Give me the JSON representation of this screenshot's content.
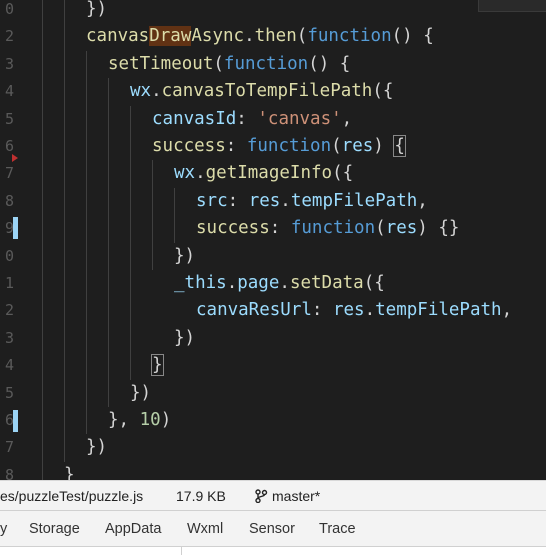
{
  "editor": {
    "line_numbers": [
      "0",
      "2",
      "3",
      "4",
      "5",
      "6",
      "7",
      "8",
      "9",
      "0",
      "1",
      "2",
      "3",
      "4",
      "5",
      "6",
      "7",
      "8"
    ],
    "lines": [
      {
        "tokens": [
          {
            "t": "})",
            "c": "plain"
          }
        ]
      },
      {
        "tokens": [
          {
            "t": "canvas",
            "c": "fn"
          },
          {
            "t": "Draw",
            "c": "fn",
            "hl": true
          },
          {
            "t": "Async",
            "c": "fn"
          },
          {
            "t": ".",
            "c": "plain"
          },
          {
            "t": "then",
            "c": "fn"
          },
          {
            "t": "(",
            "c": "plain"
          },
          {
            "t": "function",
            "c": "kw"
          },
          {
            "t": "() {",
            "c": "plain"
          }
        ]
      },
      {
        "tokens": [
          {
            "t": "setTimeout",
            "c": "fn"
          },
          {
            "t": "(",
            "c": "plain"
          },
          {
            "t": "function",
            "c": "kw"
          },
          {
            "t": "() {",
            "c": "plain"
          }
        ]
      },
      {
        "tokens": [
          {
            "t": "wx",
            "c": "prop"
          },
          {
            "t": ".",
            "c": "plain"
          },
          {
            "t": "canvasToTempFilePath",
            "c": "fn"
          },
          {
            "t": "({",
            "c": "plain"
          }
        ]
      },
      {
        "tokens": [
          {
            "t": "canvasId",
            "c": "prop"
          },
          {
            "t": ": ",
            "c": "plain"
          },
          {
            "t": "'canvas'",
            "c": "str"
          },
          {
            "t": ",",
            "c": "plain"
          }
        ]
      },
      {
        "tokens": [
          {
            "t": "success",
            "c": "fn"
          },
          {
            "t": ": ",
            "c": "plain"
          },
          {
            "t": "function",
            "c": "kw"
          },
          {
            "t": "(",
            "c": "plain"
          },
          {
            "t": "res",
            "c": "prop"
          },
          {
            "t": ") ",
            "c": "plain"
          },
          {
            "t": "{",
            "c": "plain",
            "box": true
          }
        ]
      },
      {
        "tokens": [
          {
            "t": "wx",
            "c": "prop"
          },
          {
            "t": ".",
            "c": "plain"
          },
          {
            "t": "getImageInfo",
            "c": "fn"
          },
          {
            "t": "({",
            "c": "plain"
          }
        ]
      },
      {
        "tokens": [
          {
            "t": "src",
            "c": "prop"
          },
          {
            "t": ": ",
            "c": "plain"
          },
          {
            "t": "res",
            "c": "prop"
          },
          {
            "t": ".",
            "c": "plain"
          },
          {
            "t": "tempFilePath",
            "c": "prop"
          },
          {
            "t": ",",
            "c": "plain"
          }
        ]
      },
      {
        "tokens": [
          {
            "t": "success",
            "c": "fn"
          },
          {
            "t": ": ",
            "c": "plain"
          },
          {
            "t": "function",
            "c": "kw"
          },
          {
            "t": "(",
            "c": "plain"
          },
          {
            "t": "res",
            "c": "prop"
          },
          {
            "t": ") {}",
            "c": "plain"
          }
        ]
      },
      {
        "tokens": [
          {
            "t": "})",
            "c": "plain"
          }
        ]
      },
      {
        "tokens": [
          {
            "t": "_this",
            "c": "prop"
          },
          {
            "t": ".",
            "c": "plain"
          },
          {
            "t": "page",
            "c": "prop"
          },
          {
            "t": ".",
            "c": "plain"
          },
          {
            "t": "setData",
            "c": "fn"
          },
          {
            "t": "({",
            "c": "plain"
          }
        ]
      },
      {
        "tokens": [
          {
            "t": "canvaResUrl",
            "c": "prop"
          },
          {
            "t": ": ",
            "c": "plain"
          },
          {
            "t": "res",
            "c": "prop"
          },
          {
            "t": ".",
            "c": "plain"
          },
          {
            "t": "tempFilePath",
            "c": "prop"
          },
          {
            "t": ",",
            "c": "plain"
          }
        ]
      },
      {
        "tokens": [
          {
            "t": "})",
            "c": "plain"
          }
        ]
      },
      {
        "tokens": [
          {
            "t": "}",
            "c": "plain",
            "box": true
          }
        ]
      },
      {
        "tokens": [
          {
            "t": "})",
            "c": "plain"
          }
        ]
      },
      {
        "tokens": [
          {
            "t": "}, ",
            "c": "plain"
          },
          {
            "t": "10",
            "c": "num"
          },
          {
            "t": ")",
            "c": "plain"
          }
        ]
      },
      {
        "tokens": [
          {
            "t": "})",
            "c": "plain"
          }
        ]
      },
      {
        "tokens": [
          {
            "t": "}",
            "c": "plain"
          }
        ]
      }
    ]
  },
  "status_bar": {
    "file_path": "es/puzzleTest/puzzle.js",
    "file_size": "17.9 KB",
    "branch_icon": "git-branch-icon",
    "branch": "master*"
  },
  "devtools_tabs": [
    "y",
    "Storage",
    "AppData",
    "Wxml",
    "Sensor",
    "Trace"
  ]
}
